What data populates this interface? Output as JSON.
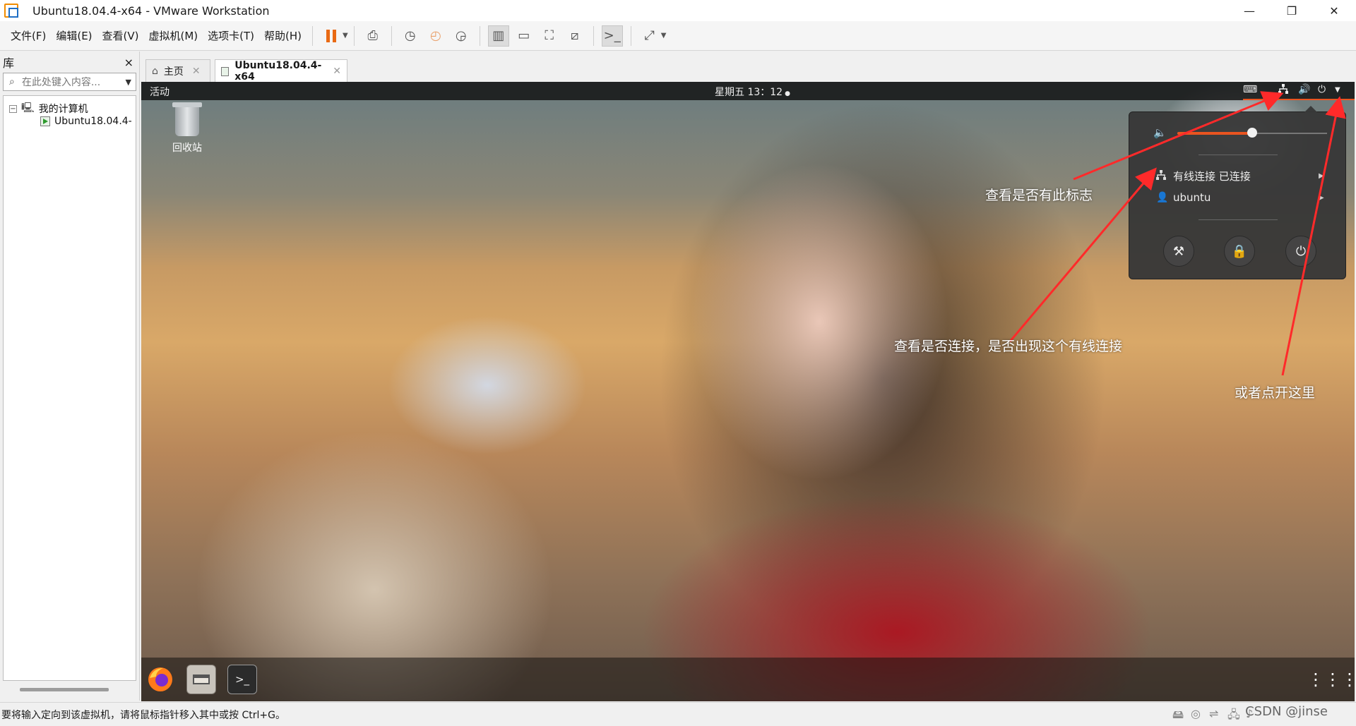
{
  "window": {
    "title": "Ubuntu18.04.4-x64 - VMware Workstation",
    "minimize": "—",
    "restore": "❐",
    "close": "✕"
  },
  "menu": [
    "文件(F)",
    "编辑(E)",
    "查看(V)",
    "虚拟机(M)",
    "选项卡(T)",
    "帮助(H)"
  ],
  "toolbar": {
    "icons": [
      "pause-icon",
      "send-keys-icon",
      "snapshot-icon",
      "revert-snapshot-icon",
      "snapshot-manager-icon",
      "library-view-icon",
      "thumbnail-view-icon",
      "full-screen-icon",
      "unity-icon",
      "console-icon",
      "stretch-icon"
    ]
  },
  "library": {
    "title": "库",
    "close": "×",
    "search_placeholder": "在此处键入内容...",
    "tree": [
      {
        "label": "我的计算机",
        "expander": "−"
      },
      {
        "label": "Ubuntu18.04.4-"
      }
    ]
  },
  "tabs": [
    {
      "label": "主页",
      "icon": "home-icon",
      "close": "✕"
    },
    {
      "label": "Ubuntu18.04.4-x64",
      "icon": "vm-icon",
      "close": "✕"
    }
  ],
  "guest": {
    "activities": "活动",
    "clock": "星期五 13：12",
    "trash_label": "回收站",
    "system_menu": {
      "volume_level": 0.5,
      "wired_label": "有线连接 已连接",
      "user_label": "ubuntu",
      "buttons": [
        "settings-icon",
        "lock-icon",
        "power-icon"
      ]
    },
    "dock": [
      "firefox-icon",
      "files-icon",
      "terminal-icon"
    ],
    "apps_grid_icon": "app-grid-icon"
  },
  "annotations": {
    "check_icon": "查看是否有此标志",
    "check_connection": "查看是否连接，是否出现这个有线连接",
    "or_open_here": "或者点开这里"
  },
  "colors": {
    "accent": "#e95420",
    "arrow": "#ff2a2a"
  },
  "statusbar": {
    "message": "要将输入定向到该虚拟机，请将鼠标指针移入其中或按 Ctrl+G。",
    "watermark": "CSDN @jinse"
  }
}
